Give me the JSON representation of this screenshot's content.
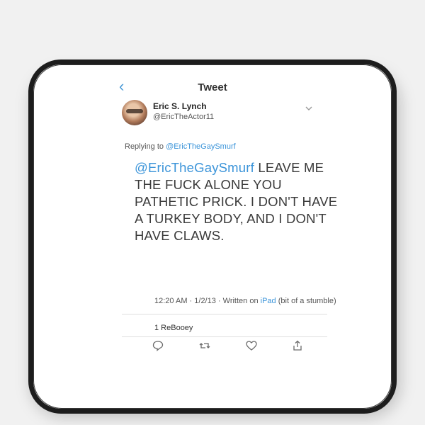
{
  "header": {
    "title": "Tweet",
    "back_icon": "chevron-left-icon"
  },
  "tweet": {
    "author_name": "Eric S. Lynch",
    "author_handle": "@EricTheActor11",
    "menu_icon": "chevron-down-icon",
    "replying_label": "Replying to",
    "replying_handle": "@EricTheGaySmurf",
    "mention": "@EricTheGaySmurf",
    "text": "LEAVE ME THE FUCK ALONE YOU PATHETIC PRICK. I DON'T HAVE A TURKEY BODY, AND I DON'T HAVE CLAWS.",
    "time": "12:20 AM",
    "date": "1/2/13",
    "written_on_label": "Written on",
    "client": "iPad",
    "client_note": "(bit of a stumble)",
    "stats": "1 ReBooey"
  },
  "actions": [
    {
      "name": "reply",
      "icon": "reply-icon"
    },
    {
      "name": "retweet",
      "icon": "retweet-icon"
    },
    {
      "name": "like",
      "icon": "heart-icon"
    },
    {
      "name": "share",
      "icon": "share-icon"
    }
  ],
  "colors": {
    "link": "#3b94d9",
    "text": "#3b3b3b",
    "border": "#1d1d1d"
  }
}
